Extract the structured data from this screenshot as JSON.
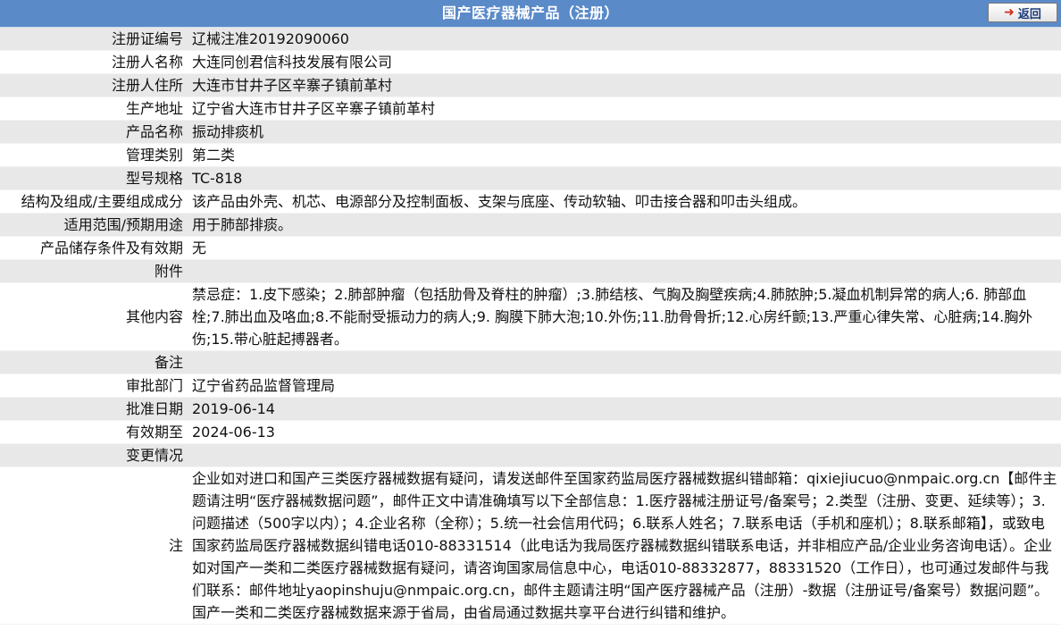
{
  "header": {
    "title": "国产医疗器械产品（注册）",
    "back_label": "返回"
  },
  "rows": [
    {
      "label": "注册证编号",
      "value": "辽械注准20192090060"
    },
    {
      "label": "注册人名称",
      "value": "大连同创君信科技发展有限公司"
    },
    {
      "label": "注册人住所",
      "value": "大连市甘井子区辛寨子镇前革村"
    },
    {
      "label": "生产地址",
      "value": "辽宁省大连市甘井子区辛寨子镇前革村"
    },
    {
      "label": "产品名称",
      "value": "振动排痰机"
    },
    {
      "label": "管理类别",
      "value": "第二类"
    },
    {
      "label": "型号规格",
      "value": "TC-818"
    },
    {
      "label": "结构及组成/主要组成成分",
      "value": "该产品由外壳、机芯、电源部分及控制面板、支架与底座、传动软轴、叩击接合器和叩击头组成。"
    },
    {
      "label": "适用范围/预期用途",
      "value": "用于肺部排痰。"
    },
    {
      "label": "产品储存条件及有效期",
      "value": "无"
    },
    {
      "label": "附件",
      "value": ""
    },
    {
      "label": "其他内容",
      "value": "禁忌症：1.皮下感染；2.肺部肿瘤（包括肋骨及脊柱的肿瘤）;3.肺结核、气胸及胸壁疾病;4.肺脓肿;5.凝血机制异常的病人;6. 肺部血栓;7.肺出血及咯血;8.不能耐受振动力的病人;9. 胸膜下肺大泡;10.外伤;11.肋骨骨折;12.心房纤颤;13.严重心律失常、心脏病;14.胸外伤;15.带心脏起搏器者。"
    },
    {
      "label": "备注",
      "value": ""
    },
    {
      "label": "审批部门",
      "value": "辽宁省药品监督管理局"
    },
    {
      "label": "批准日期",
      "value": "2019-06-14"
    },
    {
      "label": "有效期至",
      "value": "2024-06-13"
    },
    {
      "label": "变更情况",
      "value": ""
    },
    {
      "label": "注",
      "value": "企业如对进口和国产三类医疗器械数据有疑问，请发送邮件至国家药监局医疗器械数据纠错邮箱：qixiejiucuo@nmpaic.org.cn【邮件主题请注明“医疗器械数据问题”，邮件正文中请准确填写以下全部信息：1.医疗器械注册证号/备案号；2.类型（注册、变更、延续等）；3.问题描述（500字以内）；4.企业名称（全称）；5.统一社会信用代码；6.联系人姓名；7.联系电话（手机和座机）；8.联系邮箱】，或致电国家药监局医疗器械数据纠错电话010-88331514（此电话为我局医疗器械数据纠错联系电话，并非相应产品/企业业务咨询电话）。企业如对国产一类和二类医疗器械数据有疑问，请咨询国家局信息中心，电话010-88332877，88331520（工作日），也可通过发邮件与我们联系：邮件地址yaopinshuju@nmpaic.org.cn，邮件主题请注明“国产医疗器械产品（注册）-数据（注册证号/备案号）数据问题”。国产一类和二类医疗器械数据来源于省局，由省局通过数据共享平台进行纠错和维护。"
    }
  ]
}
